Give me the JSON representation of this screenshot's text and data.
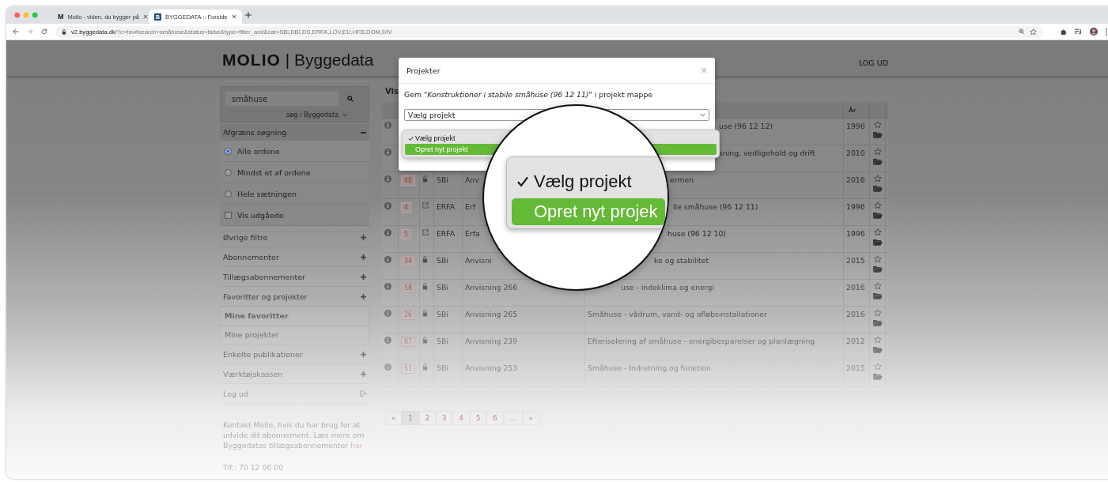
{
  "browser": {
    "tabs": [
      {
        "title": "Molio - viden, du bygger på",
        "icon": "M",
        "selected": false
      },
      {
        "title": "BYGGEDATA :: Forside",
        "icon": "B",
        "selected": true
      }
    ],
    "url": {
      "host": "v2.byggedata.dk",
      "path": "/?c=fav#search=småhuse&status=false&type=filter_and&cat=SBi,DBI,DS,ERFA,LOV,EU,HFB,DOM,DIV"
    }
  },
  "header": {
    "logo": "**MOLIO** | Byggedata",
    "logout": "LOG UD"
  },
  "sidebar": {
    "search": {
      "value": "småhuse"
    },
    "scope": "søg i Byggedata",
    "filter": {
      "label": "Afgræns søgning",
      "expanded": true
    },
    "options": [
      {
        "kind": "radio",
        "label": "Alle ordene",
        "selected": true
      },
      {
        "kind": "radio",
        "label": "Mindst et af ordene",
        "selected": false
      },
      {
        "kind": "radio",
        "label": "Hele sætningen",
        "selected": false
      },
      {
        "kind": "checkbox",
        "label": "Vis udgåede",
        "checked": false
      }
    ],
    "items": [
      {
        "kind": "section",
        "label": "Øvrige filtre"
      },
      {
        "kind": "section",
        "label": "Abonnementer"
      },
      {
        "kind": "section",
        "label": "Tillægsabonnementer"
      },
      {
        "kind": "section",
        "label": "Favoritter og projekter"
      },
      {
        "kind": "subitem",
        "label": "Mine favoritter",
        "selected": true
      },
      {
        "kind": "subitem",
        "label": "Mine projekter",
        "selected": false
      },
      {
        "kind": "section",
        "label": "Enkelte publikationer"
      },
      {
        "kind": "section",
        "label": "Værktøjskassen"
      },
      {
        "kind": "logout",
        "label": "Log ud"
      }
    ],
    "info": {
      "text": "Kontakt Molio, hvis du har brug for at udvide dit abonnement. Læs mere om Byggedatas tillægsabonnementer",
      "link": "her",
      "phone": "Tlf.: 70 12 06 00"
    }
  },
  "main": {
    "heading": "Vis",
    "columns": {
      "year": "År"
    },
    "rows": [
      {
        "title": "use (96 12 12)",
        "year": "1996"
      },
      {
        "title": "sning, vedligehold og drift",
        "year": "2010"
      },
      {
        "count": "48",
        "kind": "lock",
        "publisher": "SBi",
        "source": "Anv",
        "title": "ermen",
        "year": "2016"
      },
      {
        "count": "4",
        "kind": "external",
        "publisher": "ERFA",
        "source": "Erf",
        "title": "ile småhuse (96 12 11)",
        "year": "1996"
      },
      {
        "count": "5",
        "kind": "external",
        "publisher": "ERFA",
        "source": "Erfa",
        "title": "huse (96 12 10)",
        "year": "1996"
      },
      {
        "count": "34",
        "kind": "lock",
        "publisher": "SBi",
        "source": "Anvisni",
        "title": "ke og stabilitet",
        "year": "2015"
      },
      {
        "count": "58",
        "kind": "lock",
        "publisher": "SBi",
        "source": "Anvisning 266",
        "title": "use - indeklima og energi",
        "year": "2016"
      },
      {
        "count": "26",
        "kind": "lock",
        "publisher": "SBi",
        "source": "Anvisning 265",
        "title": "Småhuse - vådrum, vand- og afløbsinstallationer",
        "year": "2016"
      },
      {
        "count": "67",
        "kind": "lock",
        "publisher": "SBi",
        "source": "Anvisning 239",
        "title": "Efterisolering af småhuse - energibesparelser og planlægning",
        "year": "2012"
      },
      {
        "count": "61",
        "kind": "lock",
        "publisher": "SBi",
        "source": "Anvisning 253",
        "title": "Småhuse - Indretning og funktion",
        "year": "2015"
      }
    ],
    "pagination": [
      {
        "label": "«",
        "selected": false
      },
      {
        "label": "1",
        "selected": true
      },
      {
        "label": "2",
        "selected": false
      },
      {
        "label": "3",
        "selected": false
      },
      {
        "label": "4",
        "selected": false
      },
      {
        "label": "5",
        "selected": false
      },
      {
        "label": "6",
        "selected": false
      },
      {
        "label": "...",
        "selected": false
      },
      {
        "label": "»",
        "selected": false
      }
    ]
  },
  "modal": {
    "title": "Projekter",
    "message": "Gem \"*Konstruktioner i stabile småhuse (96 12 11)*\" i projekt mappe",
    "select": "Vælg projekt",
    "options": [
      {
        "label": "Vælg projekt",
        "checked": true,
        "selected": false
      },
      {
        "label": "Opret nyt projekt",
        "checked": false,
        "selected": true
      }
    ]
  },
  "magnifier": {
    "options": [
      {
        "label": "Vælg projekt",
        "checked": true,
        "selected": false
      },
      {
        "label": "Opret nyt projek",
        "checked": false,
        "selected": true
      }
    ]
  }
}
